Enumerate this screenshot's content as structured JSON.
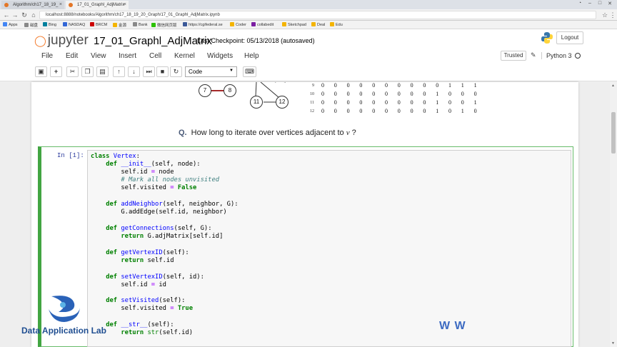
{
  "browser": {
    "tabs": [
      {
        "title": "Algorithm/ch17_18_19_"
      },
      {
        "title": "17_01_Graphl_AdjMatrix"
      }
    ],
    "url": "localhost:8888/notebooks/Algorithm/ch17_18_19_20_Graph/17_01_Graphl_AdjMatrix.ipynb",
    "bookmarks": [
      "Apps",
      "磁盘",
      "Bing",
      "NASDAQ",
      "BRCM",
      "金源",
      "Bank",
      "微信网页版",
      "https://cgifederal.se",
      "Coder",
      "collabedit",
      "Sketchpad",
      "Deal",
      "Edu"
    ]
  },
  "header": {
    "logo_text": "jupyter",
    "notebook_title": "17_01_Graphl_AdjMatrix",
    "checkpoint": "Last Checkpoint: 05/13/2018 (autosaved)",
    "logout": "Logout"
  },
  "menu": {
    "items": [
      "File",
      "Edit",
      "View",
      "Insert",
      "Cell",
      "Kernel",
      "Widgets",
      "Help"
    ],
    "trusted": "Trusted",
    "kernel_name": "Python 3"
  },
  "toolbar": {
    "cell_type": "Code",
    "icons": [
      "save-icon",
      "add-cell-icon",
      "cut-icon",
      "copy-icon",
      "paste-icon",
      "move-up-icon",
      "move-down-icon",
      "run-icon",
      "stop-icon",
      "restart-icon",
      "keyboard-icon"
    ]
  },
  "markdown_cell": {
    "graph_nodes": [
      "7",
      "8",
      "11",
      "12"
    ],
    "matrix_rows": [
      {
        "label": "9",
        "values": [
          "0",
          "0",
          "0",
          "0",
          "0",
          "0",
          "0",
          "0",
          "0",
          "0",
          "1",
          "1",
          "1"
        ]
      },
      {
        "label": "10",
        "values": [
          "0",
          "0",
          "0",
          "0",
          "0",
          "0",
          "0",
          "0",
          "0",
          "1",
          "0",
          "0",
          "0"
        ]
      },
      {
        "label": "11",
        "values": [
          "0",
          "0",
          "0",
          "0",
          "0",
          "0",
          "0",
          "0",
          "0",
          "1",
          "0",
          "0",
          "1"
        ]
      },
      {
        "label": "12",
        "values": [
          "0",
          "0",
          "0",
          "0",
          "0",
          "0",
          "0",
          "0",
          "0",
          "1",
          "0",
          "1",
          "0"
        ]
      }
    ],
    "question_label": "Q.",
    "question_text": "How long to iterate over vertices adjacent to",
    "question_var": "v",
    "question_end": "?"
  },
  "code_cell": {
    "prompt": "In [1]:"
  },
  "watermark": {
    "brand": "Data Application Lab",
    "corner_text": "W W"
  },
  "colors": {
    "jupyter_orange": "#f37726",
    "cell_selected_border": "#42a542",
    "watermark_blue": "#1f4e91"
  }
}
